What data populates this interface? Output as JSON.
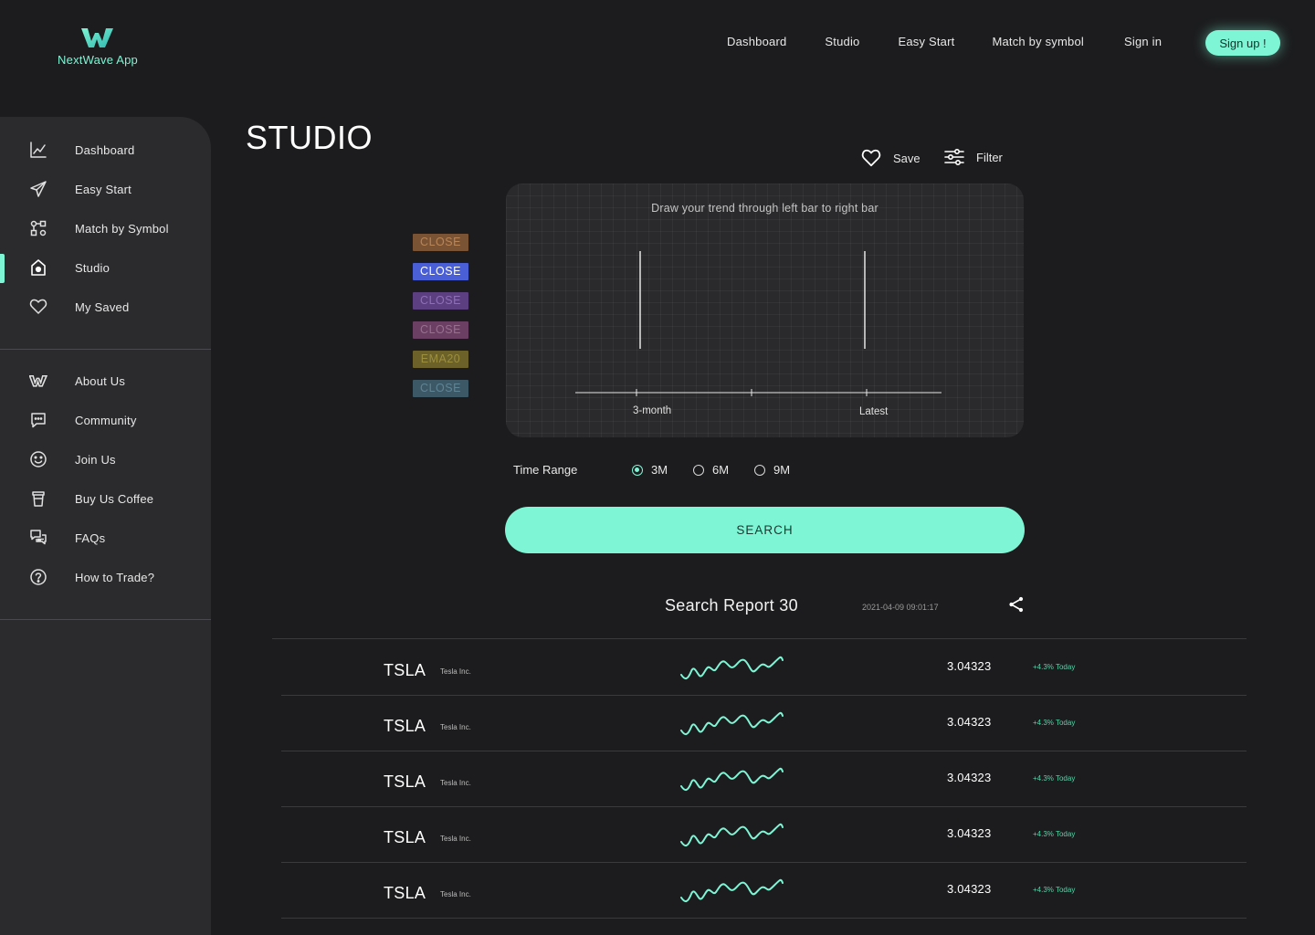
{
  "app": {
    "name": "NextWave App",
    "accent": "#7ef5d4"
  },
  "topnav": {
    "items": [
      "Dashboard",
      "Studio",
      "Easy Start",
      "Match by symbol",
      "Sign in"
    ],
    "signup_label": "Sign up !"
  },
  "sidebar": {
    "primary": [
      {
        "label": "Dashboard",
        "icon": "chart-line-icon"
      },
      {
        "label": "Easy Start",
        "icon": "paper-plane-icon"
      },
      {
        "label": "Match by Symbol",
        "icon": "match-nodes-icon"
      },
      {
        "label": "Studio",
        "icon": "studio-house-icon",
        "active": true
      },
      {
        "label": "My Saved",
        "icon": "heart-icon"
      }
    ],
    "secondary": [
      {
        "label": "About Us",
        "icon": "logo-mark-icon"
      },
      {
        "label": "Community",
        "icon": "chat-bubble-icon"
      },
      {
        "label": "Join Us",
        "icon": "smiley-icon"
      },
      {
        "label": "Buy Us Coffee",
        "icon": "coffee-cup-icon"
      },
      {
        "label": "FAQs",
        "icon": "faq-chat-icon"
      },
      {
        "label": "How to Trade?",
        "icon": "question-circle-icon"
      }
    ]
  },
  "studio": {
    "title": "STUDIO",
    "save_label": "Save",
    "filter_label": "Filter",
    "canvas_hint": "Draw your trend through left bar to right bar",
    "axis_labels": [
      "3-month",
      "Latest"
    ],
    "tags": [
      {
        "label": "CLOSE",
        "bg": "#7a5334",
        "fg": "#b98556"
      },
      {
        "label": "CLOSE",
        "bg": "#4a5fd6",
        "fg": "#ffffff"
      },
      {
        "label": "CLOSE",
        "bg": "#5c3f80",
        "fg": "#8e6fb7"
      },
      {
        "label": "CLOSE",
        "bg": "#6a3f63",
        "fg": "#98708e"
      },
      {
        "label": "EMA20",
        "bg": "#6b6129",
        "fg": "#9c8f3f"
      },
      {
        "label": "CLOSE",
        "bg": "#3c5866",
        "fg": "#5f8494"
      }
    ],
    "time_range_label": "Time Range",
    "time_options": [
      "3M",
      "6M",
      "9M"
    ],
    "time_selected": "3M",
    "search_label": "SEARCH"
  },
  "report": {
    "title": "Search Report 30",
    "date": "2021-04-09 09:01:17",
    "rows": [
      {
        "symbol": "TSLA",
        "company": "Tesla Inc.",
        "value": "3.04323",
        "change": "+4.3% Today"
      },
      {
        "symbol": "TSLA",
        "company": "Tesla Inc.",
        "value": "3.04323",
        "change": "+4.3% Today"
      },
      {
        "symbol": "TSLA",
        "company": "Tesla Inc.",
        "value": "3.04323",
        "change": "+4.3% Today"
      },
      {
        "symbol": "TSLA",
        "company": "Tesla Inc.",
        "value": "3.04323",
        "change": "+4.3% Today"
      },
      {
        "symbol": "TSLA",
        "company": "Tesla Inc.",
        "value": "3.04323",
        "change": "+4.3% Today"
      }
    ]
  }
}
